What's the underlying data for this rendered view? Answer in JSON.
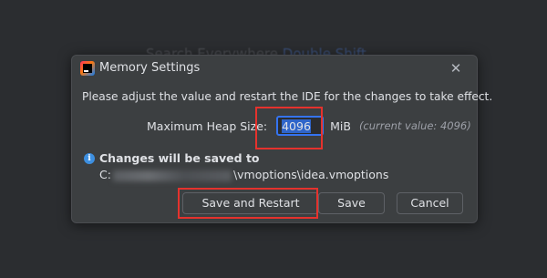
{
  "background": {
    "hint_text": "Search Everywhere",
    "hint_highlight": "Double Shift"
  },
  "dialog": {
    "title": "Memory Settings",
    "close_symbol": "✕",
    "message": "Please adjust the value and restart the IDE for the changes to take effect.",
    "heap": {
      "label": "Maximum Heap Size:",
      "value": "4096",
      "unit": "MiB",
      "current_value": "(current value: 4096)"
    },
    "save_info": {
      "title": "Changes will be saved to",
      "path_prefix": "C:",
      "path_suffix": "\\vmoptions\\idea.vmoptions"
    },
    "buttons": {
      "save_restart": "Save and Restart",
      "save": "Save",
      "cancel": "Cancel"
    }
  },
  "colors": {
    "accent": "#3574f0",
    "highlight_annotation": "#e5322d",
    "dialog_bg": "#3c3f41",
    "page_bg": "#2b2d30"
  },
  "icons": [
    "app-icon",
    "close-icon",
    "info-icon"
  ]
}
